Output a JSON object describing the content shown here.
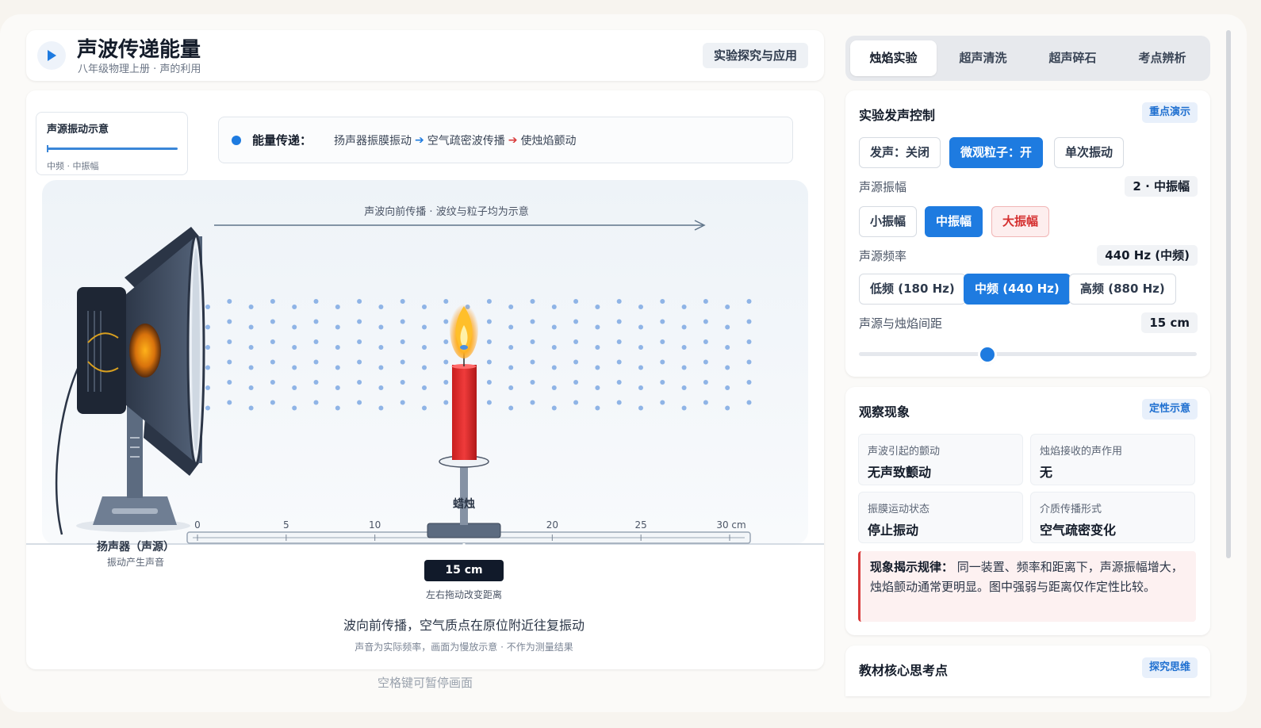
{
  "header": {
    "title": "声波传递能量",
    "subtitle": "八年级物理上册 · 声的利用",
    "tag": "实验探究与应用"
  },
  "mini_card": {
    "title": "声源振动示意",
    "sub": "中频 · 中振幅"
  },
  "energy": {
    "label": "能量传递：",
    "step1": "扬声器振膜振动",
    "step2": "空气疏密波传播",
    "step3": "使烛焰颤动",
    "arrow": "➔"
  },
  "scene": {
    "propagation_label": "声波向前传播 · 波纹与粒子均为示意",
    "candle_label": "蜡烛",
    "speaker_label": "扬声器（声源）",
    "speaker_sub": "振动产生声音",
    "ruler_ticks": [
      "0",
      "5",
      "10",
      "20",
      "25",
      "30 cm"
    ],
    "distance_badge": "15 cm",
    "drag_hint": "左右拖动改变距离",
    "wave_note": "波向前传播，空气质点在原位附近往复振动",
    "wave_sub": "声音为实际频率，画面为慢放示意 · 不作为测量结果"
  },
  "footer_hint": "空格键可暂停画面",
  "tabs": [
    "烛焰实验",
    "超声清洗",
    "超声碎石",
    "考点辨析"
  ],
  "control": {
    "title": "实验发声控制",
    "tag": "重点演示",
    "sound_btn": "发声：关闭",
    "particle_btn": "微观粒子：开",
    "single_btn": "单次振动",
    "amp_label": "声源振幅",
    "amp_value": "2 · 中振幅",
    "amp_small": "小振幅",
    "amp_mid": "中振幅",
    "amp_large": "大振幅",
    "freq_label": "声源频率",
    "freq_value": "440 Hz (中频)",
    "freq_low": "低频 (180 Hz)",
    "freq_mid": "中频 (440 Hz)",
    "freq_high": "高频 (880 Hz)",
    "dist_label": "声源与烛焰间距",
    "dist_value": "15 cm",
    "dist_slider_fraction": 0.38
  },
  "observe": {
    "title": "观察现象",
    "tag": "定性示意",
    "cells": [
      {
        "label": "声波引起的颤动",
        "value": "无声致颤动"
      },
      {
        "label": "烛焰接收的声作用",
        "value": "无"
      },
      {
        "label": "振膜运动状态",
        "value": "停止振动"
      },
      {
        "label": "介质传播形式",
        "value": "空气疏密变化"
      }
    ],
    "rule_title": "现象揭示规律：",
    "rule_text": "同一装置、频率和距离下，声源振幅增大，烛焰颤动通常更明显。图中强弱与距离仅作定性比较。"
  },
  "core": {
    "title": "教材核心思考点",
    "tag": "探究思维"
  },
  "colors": {
    "accent": "#1e7be0",
    "danger": "#d93a3a",
    "dark": "#111a2a"
  }
}
